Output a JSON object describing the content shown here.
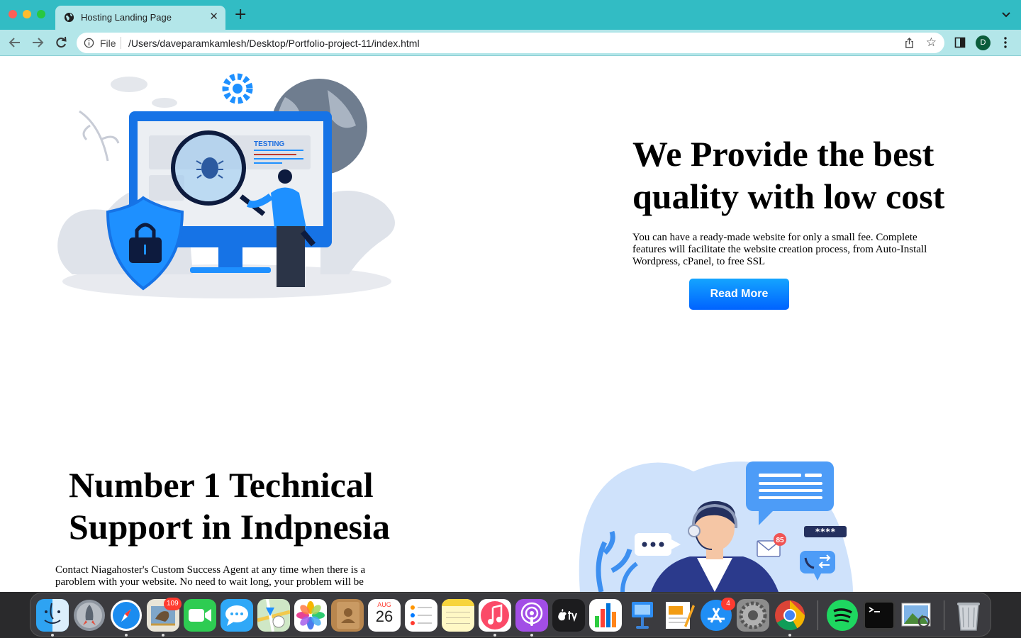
{
  "browser": {
    "tab_title": "Hosting Landing Page",
    "new_tab_symbol": "+",
    "close_symbol": "✕",
    "address_scheme_label": "File",
    "address_url": "/Users/daveparamkamlesh/Desktop/Portfolio-project-11/index.html",
    "profile_initial": "D",
    "bookmark_symbol": "☆",
    "icons": [
      "globe-icon",
      "chevron-down-icon",
      "back-arrow-icon",
      "forward-arrow-icon",
      "reload-icon",
      "info-icon",
      "share-icon",
      "star-icon",
      "side-panel-icon",
      "kebab-menu-icon"
    ],
    "accent_color": "#32bcc4"
  },
  "hero": {
    "title": "We Provide the best quality with low cost",
    "description": "You can have a ready-made website for only a small fee. Complete features will facilitate the website creation process, from Auto-Install Wordpress, cPanel, to free SSL",
    "button_label": "Read More",
    "illustration_label": "TESTING",
    "button_color": "#0a7cff"
  },
  "support_section": {
    "title": "Number 1 Technical Support in Indpnesia",
    "description": "Contact Niagahoster's Custom Success Agent at any time when there is a paroblem with your website. No need to wait long, your problem will be",
    "notification_count": "85",
    "password_mask": "****"
  },
  "dock": {
    "calendar_month": "AUG",
    "calendar_day": "26",
    "mail_badge": "109",
    "appstore_badge": "4",
    "apps": [
      "finder",
      "launchpad",
      "safari",
      "mail",
      "facetime",
      "messages",
      "maps",
      "photos",
      "contacts",
      "calendar",
      "reminders",
      "notes",
      "music",
      "podcasts",
      "apple-tv",
      "numbers",
      "keynote",
      "pages",
      "app-store",
      "system-preferences",
      "chrome",
      "spotify",
      "terminal",
      "preview",
      "trash"
    ]
  }
}
